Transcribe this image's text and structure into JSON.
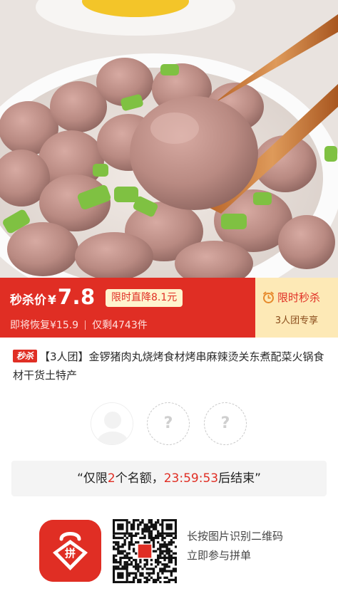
{
  "banner": {
    "price_prefix": "秒杀价",
    "currency": "¥",
    "price": "7.8",
    "drop_tag": "限时直降8.1元",
    "restore_text": "即将恢复¥15.9",
    "stock_text": "仅剩4743件",
    "flash_label": "限时秒杀",
    "group_label": "3人团专享",
    "accent_color": "#e02e24",
    "side_panel_color": "#fde9b6"
  },
  "product": {
    "badge": "秒杀",
    "title": "【3人团】金锣猪肉丸烧烤食材烤串麻辣烫关东煮配菜火锅食材干货土特产"
  },
  "group": {
    "empty_slot_symbol": "?"
  },
  "notice": {
    "open_quote": "“",
    "text_before": "仅限",
    "count": "2",
    "text_middle": "个名额，",
    "countdown": "23:59:53",
    "text_after": "后结束",
    "close_quote": "”"
  },
  "footer": {
    "logo_text": "拼",
    "line1": "长按图片识别二维码",
    "line2": "立即参与拼单"
  }
}
